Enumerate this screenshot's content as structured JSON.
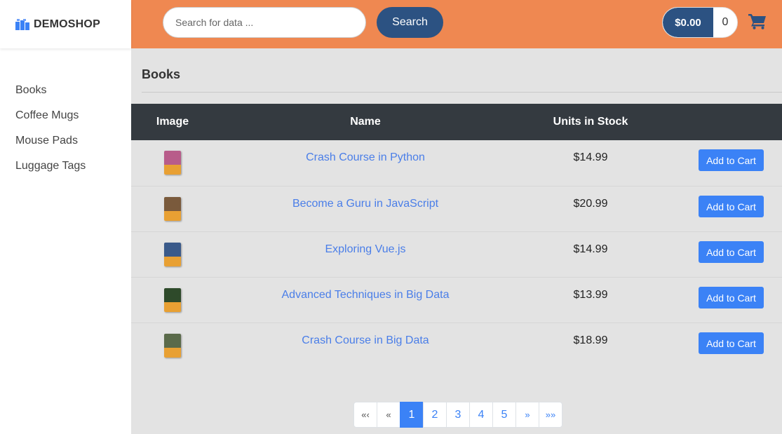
{
  "brand": {
    "name": "DEMOSHOP"
  },
  "sidebar": {
    "items": [
      {
        "label": "Books"
      },
      {
        "label": "Coffee Mugs"
      },
      {
        "label": "Mouse Pads"
      },
      {
        "label": "Luggage Tags"
      }
    ]
  },
  "header": {
    "search_placeholder": "Search for data ...",
    "search_button": "Search",
    "cart_total": "$0.00",
    "cart_count": "0"
  },
  "main": {
    "title": "Books",
    "columns": [
      "Image",
      "Name",
      "Units in Stock"
    ],
    "add_button_label": "Add to Cart",
    "products": [
      {
        "name": "Crash Course in Python",
        "price": "$14.99",
        "cover": "#b85c8a"
      },
      {
        "name": "Become a Guru in JavaScript",
        "price": "$20.99",
        "cover": "#7a5a3c"
      },
      {
        "name": "Exploring Vue.js",
        "price": "$14.99",
        "cover": "#3a5a8a"
      },
      {
        "name": "Advanced Techniques in Big Data",
        "price": "$13.99",
        "cover": "#2e4a2a"
      },
      {
        "name": "Crash Course in Big Data",
        "price": "$18.99",
        "cover": "#5a6a4a"
      }
    ]
  },
  "pagination": {
    "first": "«‹",
    "prev": "«",
    "pages": [
      "1",
      "2",
      "3",
      "4",
      "5"
    ],
    "active_page": "1",
    "next": "»",
    "last": "»»"
  },
  "colors": {
    "header_bg": "#ef8851",
    "accent_dark": "#2c5282",
    "button_blue": "#3b82f6",
    "table_header": "#343a40"
  }
}
